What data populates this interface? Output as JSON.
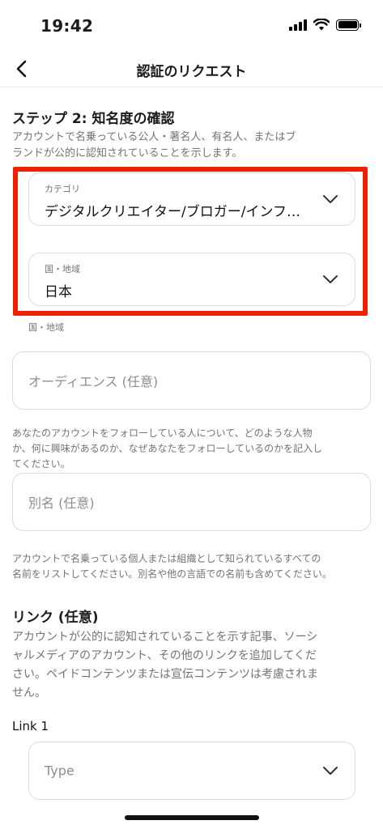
{
  "status_bar": {
    "time": "19:42"
  },
  "nav": {
    "title": "認証のリクエスト"
  },
  "step": {
    "title": "ステップ 2: 知名度の確認",
    "description": [
      "アカウントで名乗っている公人・著名人、有名人、またはブ",
      "ランドが公的に認知されていることを示します。"
    ]
  },
  "category_field": {
    "label": "カテゴリ",
    "value": "デジタルクリエイター/ブロガー/インフルエンサー"
  },
  "region_field": {
    "label": "国・地域",
    "value": "日本"
  },
  "region_helper": "国・地域",
  "audience_field": {
    "placeholder": "オーディエンス (任意)",
    "helper": [
      "あなたのアカウントをフォローしている人について、どのような人物",
      "か、何に興味があるのか、なぜあなたをフォローしているのかを記入し",
      "てください。"
    ]
  },
  "alias_field": {
    "placeholder": "別名 (任意)",
    "helper": [
      "アカウントで名乗っている個人または組織として知られているすべての",
      "名前をリストしてください。別名や他の言語での名前も含めてください。"
    ]
  },
  "links": {
    "title": "リンク (任意)",
    "description": [
      "アカウントが公的に認知されていることを示す記事、ソーシ",
      "ャルメディアのアカウント、その他のリンクを追加してくだ",
      "さい。ペイドコンテンツまたは宣伝コンテンツは考慮されま",
      "せん。"
    ],
    "link1_label": "Link 1",
    "type_placeholder": "Type"
  },
  "colors": {
    "highlight": "#ee2200",
    "border": "#dbdbdb",
    "secondary_text": "#737373"
  },
  "icons": [
    "back-chevron-icon",
    "chevron-down-icon",
    "signal-icon",
    "wifi-icon",
    "battery-icon"
  ]
}
